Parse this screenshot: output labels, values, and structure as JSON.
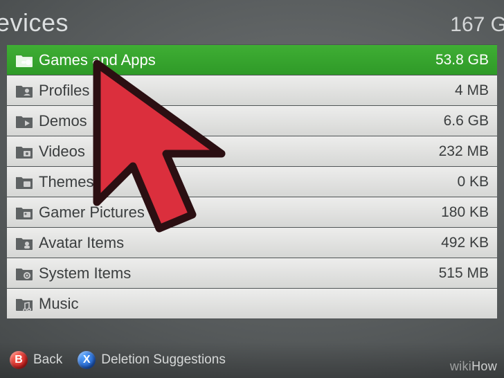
{
  "header": {
    "title": "evices",
    "total_size": "167 G"
  },
  "rows": [
    {
      "icon": "games-apps-icon",
      "label": "Games and Apps",
      "size": "53.8 GB",
      "selected": true
    },
    {
      "icon": "profiles-icon",
      "label": "Profiles",
      "size": "4 MB",
      "selected": false
    },
    {
      "icon": "demos-icon",
      "label": "Demos",
      "size": "6.6 GB",
      "selected": false
    },
    {
      "icon": "videos-icon",
      "label": "Videos",
      "size": "232 MB",
      "selected": false
    },
    {
      "icon": "themes-icon",
      "label": "Themes",
      "size": "0 KB",
      "selected": false
    },
    {
      "icon": "gamer-pictures-icon",
      "label": "Gamer Pictures",
      "size": "180 KB",
      "selected": false
    },
    {
      "icon": "avatar-items-icon",
      "label": "Avatar Items",
      "size": "492 KB",
      "selected": false
    },
    {
      "icon": "system-items-icon",
      "label": "System Items",
      "size": "515 MB",
      "selected": false
    },
    {
      "icon": "music-icon",
      "label": "Music",
      "size": "",
      "selected": false
    }
  ],
  "footer": {
    "back_button_glyph": "B",
    "back_label": "Back",
    "x_button_glyph": "X",
    "x_label": "Deletion Suggestions"
  },
  "watermark": {
    "part1": "wiki",
    "part2": "How"
  },
  "colors": {
    "selected_bg": "#34A52D",
    "row_bg": "#E3E4E2",
    "cursor_fill": "#DB2F3D",
    "cursor_stroke": "#2B0F12"
  }
}
